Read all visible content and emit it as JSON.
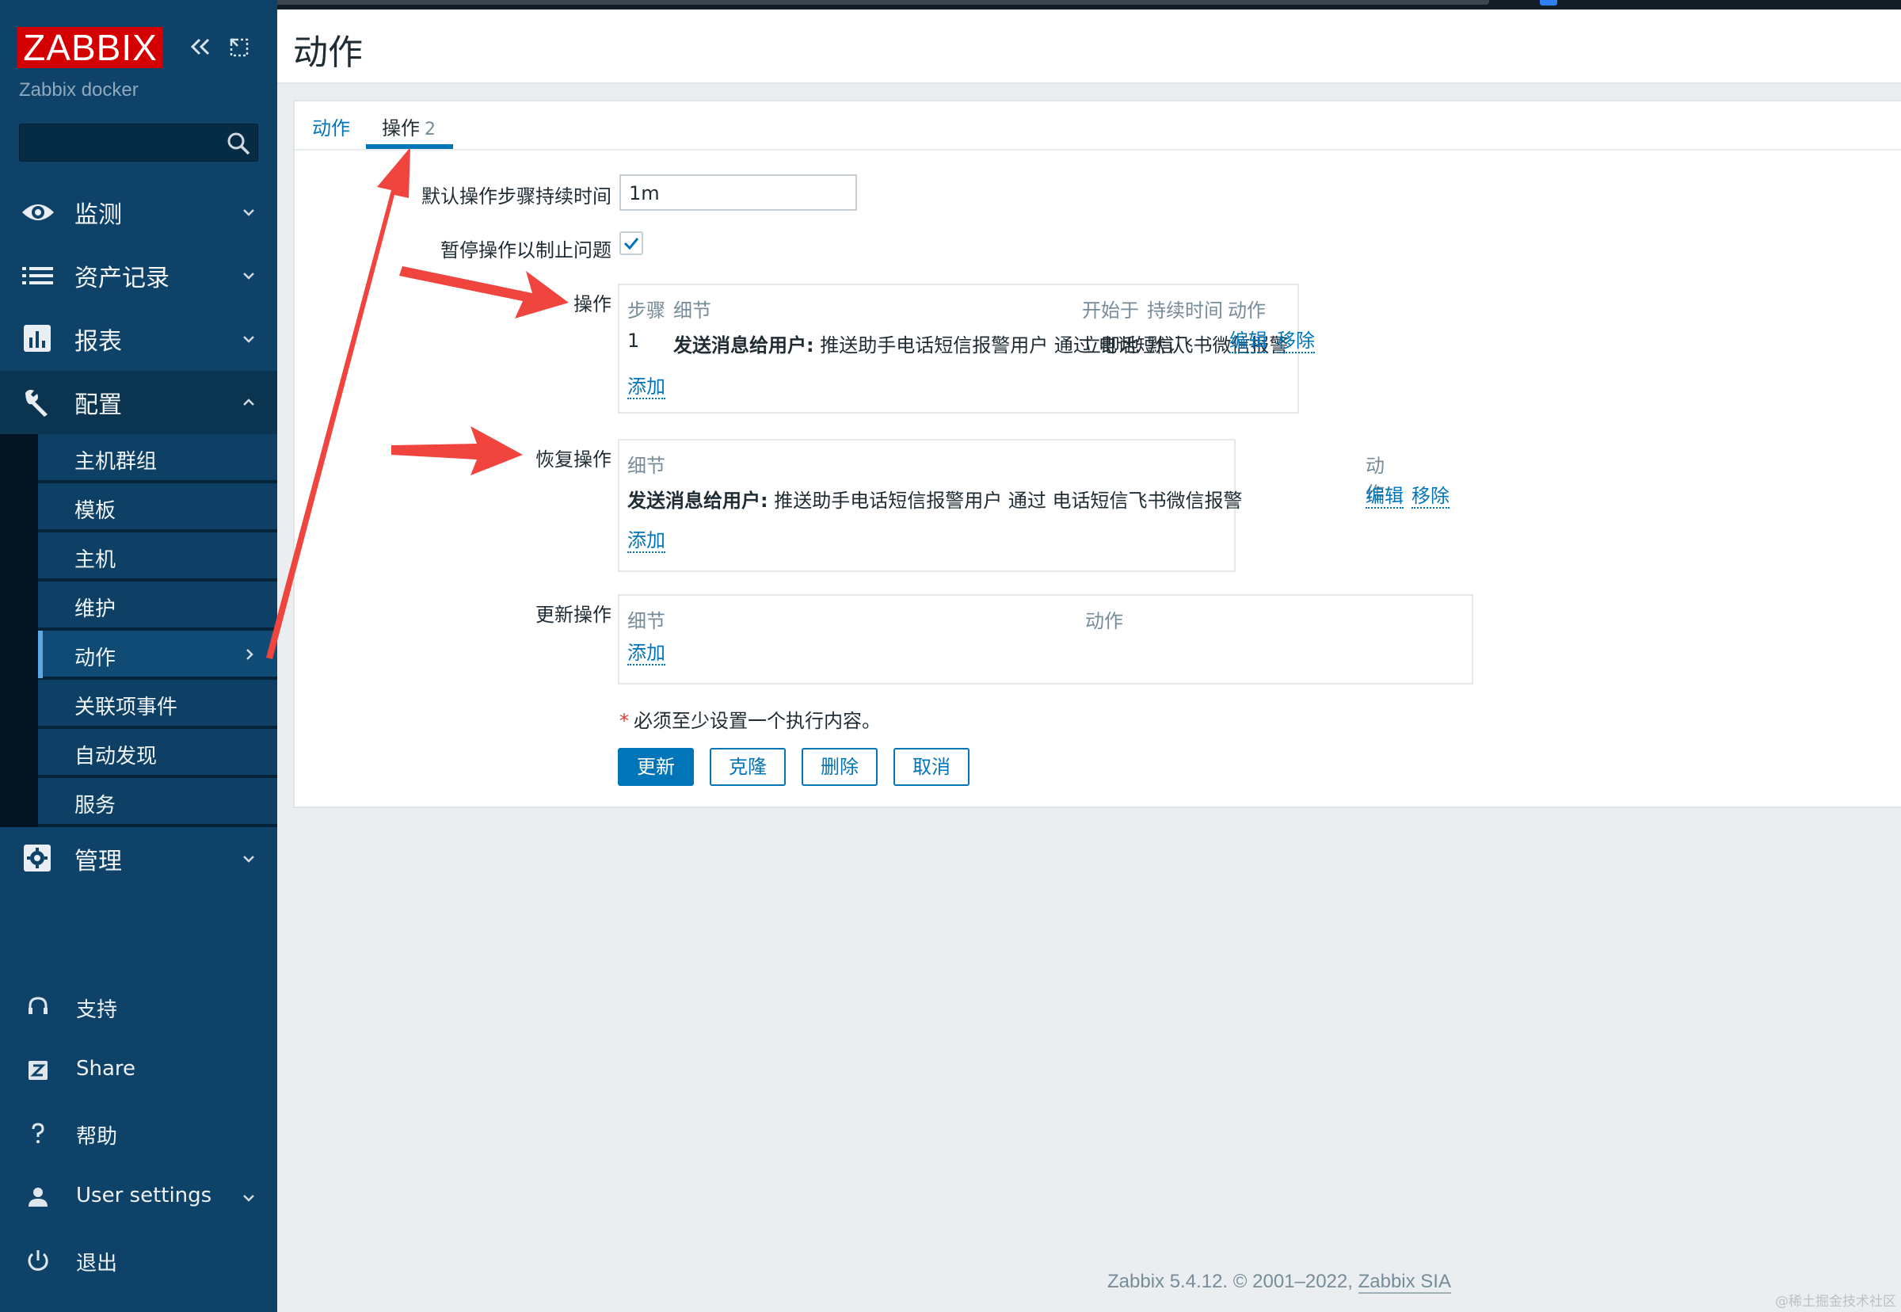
{
  "sidebar": {
    "logo": "ZABBIX",
    "server_name": "Zabbix docker",
    "search": {
      "value": "",
      "placeholder": ""
    },
    "menu": [
      {
        "label": "监测",
        "icon": "eye-icon"
      },
      {
        "label": "资产记录",
        "icon": "list-icon"
      },
      {
        "label": "报表",
        "icon": "bar-chart-icon"
      },
      {
        "label": "配置",
        "icon": "wrench-icon"
      },
      {
        "label": "管理",
        "icon": "gear-icon"
      }
    ],
    "config_submenu": [
      "主机群组",
      "模板",
      "主机",
      "维护",
      "动作",
      "关联项事件",
      "自动发现",
      "服务"
    ],
    "bottom": [
      {
        "label": "支持",
        "icon": "headset-icon"
      },
      {
        "label": "Share",
        "icon": "share-icon"
      },
      {
        "label": "帮助",
        "icon": "help-icon"
      },
      {
        "label": "User settings",
        "icon": "user-icon"
      },
      {
        "label": "退出",
        "icon": "power-icon"
      }
    ]
  },
  "header": {
    "title": "动作"
  },
  "tabs": {
    "actions_label": "动作",
    "operations_label": "操作",
    "operations_count": "2"
  },
  "form": {
    "default_step_label": "默认操作步骤持续时间",
    "default_step_value": "1m",
    "pause_label": "暂停操作以制止问题",
    "pause_checked": true,
    "operations_label": "操作",
    "operations": {
      "headers": [
        "步骤",
        "细节",
        "开始于",
        "持续时间",
        "动作"
      ],
      "rows": [
        {
          "step": "1",
          "detail_bold": "发送消息给用户:",
          "detail": "推送助手电话短信报警用户 通过 电话短信飞书微信报警",
          "start": "立即地",
          "duration": "默认",
          "edit": "编辑",
          "remove": "移除"
        }
      ],
      "add": "添加"
    },
    "recovery_label": "恢复操作",
    "recovery": {
      "headers": [
        "细节",
        "动作"
      ],
      "rows": [
        {
          "detail_bold": "发送消息给用户:",
          "detail": "推送助手电话短信报警用户 通过 电话短信飞书微信报警",
          "edit": "编辑",
          "remove": "移除"
        }
      ],
      "add": "添加"
    },
    "update_label": "更新操作",
    "update": {
      "headers": [
        "细节",
        "动作"
      ],
      "add": "添加"
    },
    "required_note": "必须至少设置一个执行内容。",
    "buttons": {
      "update": "更新",
      "clone": "克隆",
      "delete": "删除",
      "cancel": "取消"
    }
  },
  "footer": {
    "text": "Zabbix 5.4.12. © 2001–2022,",
    "link": "Zabbix SIA"
  },
  "watermark": "@稀土掘金技术社区",
  "colors": {
    "sidebar": "#0e4269",
    "accent": "#0275b8",
    "logo": "#d40000",
    "annotation": "#f0443e"
  }
}
